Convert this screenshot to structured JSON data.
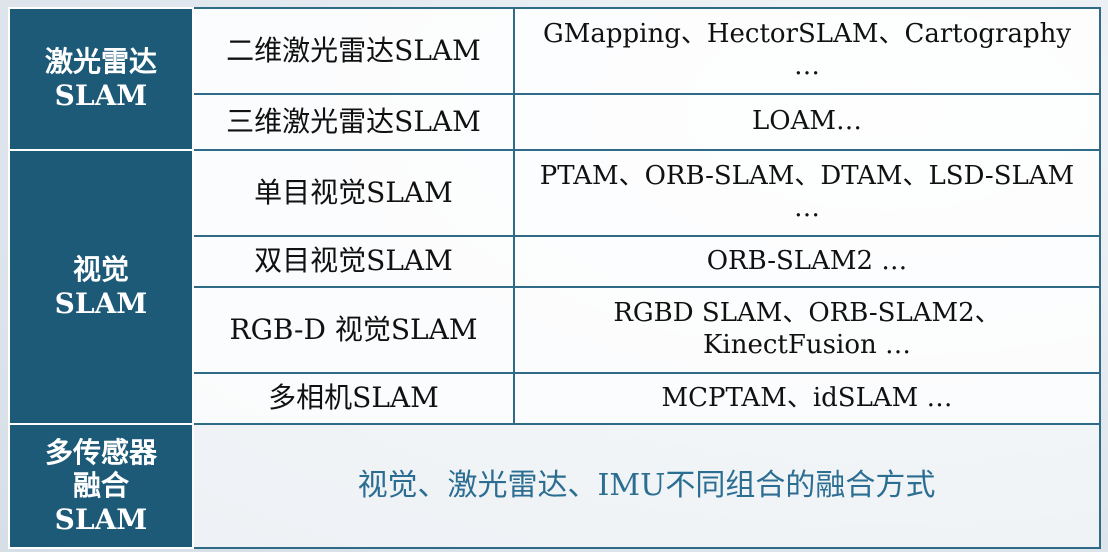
{
  "categories": [
    {
      "line1": "激光雷达",
      "line2": "SLAM"
    },
    {
      "line1": "视觉",
      "line2": "SLAM"
    },
    {
      "line1": "多传感器",
      "line2": "融合",
      "line3": "SLAM"
    }
  ],
  "rows": [
    {
      "type": "二维激光雷达SLAM",
      "examples": "GMapping、HectorSLAM、Cartography …"
    },
    {
      "type": "三维激光雷达SLAM",
      "examples": "LOAM…"
    },
    {
      "type": "单目视觉SLAM",
      "examples": "PTAM、ORB-SLAM、DTAM、LSD-SLAM …"
    },
    {
      "type": "双目视觉SLAM",
      "examples": "ORB-SLAM2 …"
    },
    {
      "type": "RGB-D 视觉SLAM",
      "examples": "RGBD SLAM、ORB-SLAM2、KinectFusion …"
    },
    {
      "type": "多相机SLAM",
      "examples": "MCPTAM、idSLAM …"
    }
  ],
  "fusion_description": "视觉、激光雷达、IMU不同组合的融合方式"
}
